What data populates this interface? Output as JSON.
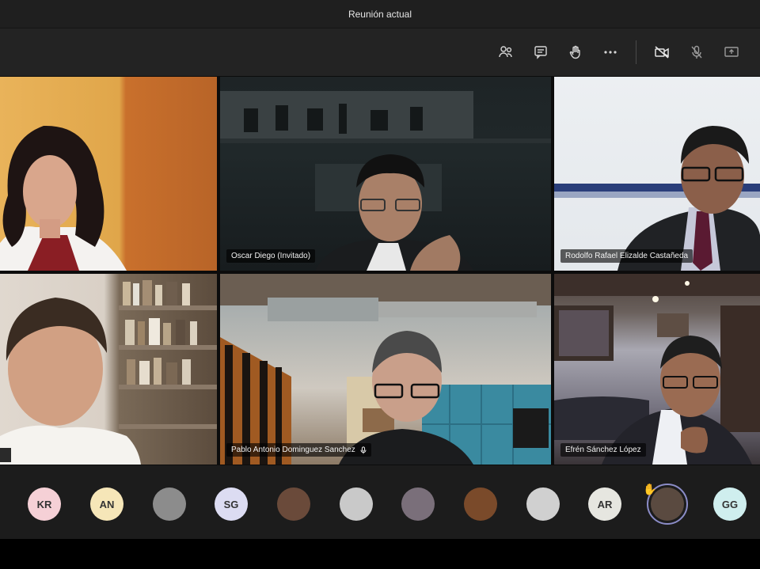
{
  "window": {
    "title": "Reunión actual"
  },
  "toolbar": {
    "buttons": [
      {
        "name": "participants-icon"
      },
      {
        "name": "chat-icon"
      },
      {
        "name": "raise-hand-icon"
      },
      {
        "name": "more-options-icon"
      },
      {
        "name": "camera-off-icon"
      },
      {
        "name": "mic-off-icon"
      },
      {
        "name": "share-screen-icon"
      }
    ]
  },
  "participants": [
    {
      "id": "p1",
      "label": ""
    },
    {
      "id": "p2",
      "label": "Oscar Diego (Invitado)"
    },
    {
      "id": "p3",
      "label": "Rodolfo Rafael Elizalde Castañeda"
    },
    {
      "id": "p4",
      "label": ""
    },
    {
      "id": "p5",
      "label": "Pablo Antonio Dominguez Sanchez"
    },
    {
      "id": "p6",
      "label": "Efrén Sánchez López"
    }
  ],
  "roster": [
    {
      "initials": "KR",
      "color": "#f5d0d6"
    },
    {
      "initials": "AN",
      "color": "#f6e6b8"
    },
    {
      "initials": "",
      "color": "#8c8c8c"
    },
    {
      "initials": "SG",
      "color": "#dcdcf2"
    },
    {
      "initials": "",
      "color": "#6a4a3a"
    },
    {
      "initials": "",
      "color": "#c9c9c9"
    },
    {
      "initials": "",
      "color": "#7a6f7a"
    },
    {
      "initials": "",
      "color": "#7a4a2a"
    },
    {
      "initials": "",
      "color": "#d0d0d0"
    },
    {
      "initials": "AR",
      "color": "#e6e6e0"
    },
    {
      "initials": "",
      "color": "#5a4a40"
    },
    {
      "initials": "GG",
      "color": "#cfeeee"
    }
  ],
  "colors": {
    "accent": "#8b8cc7",
    "hand": "#f0c040"
  }
}
